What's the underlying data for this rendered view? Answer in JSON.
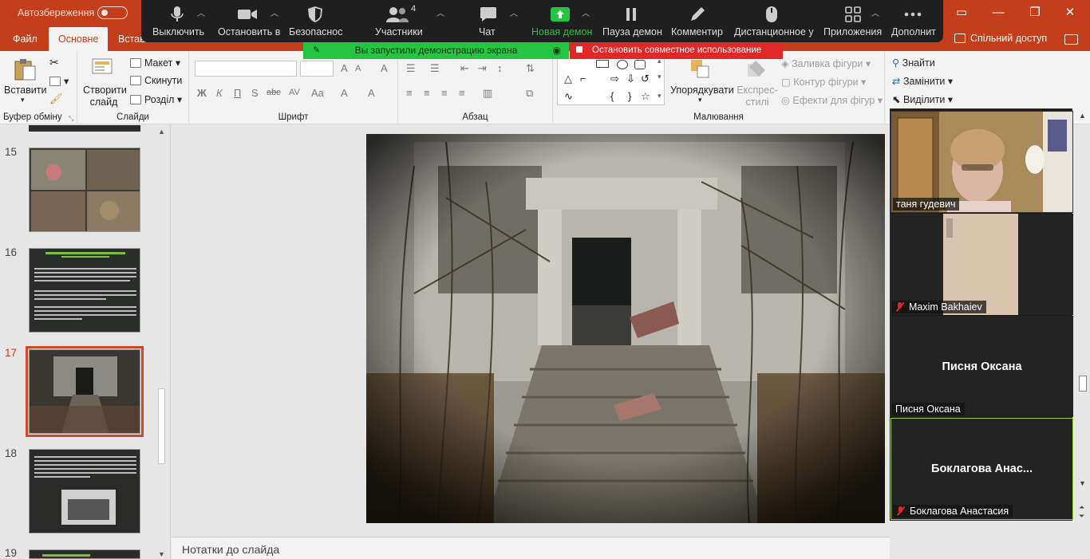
{
  "titlebar": {
    "autosave_label": "Автозбереження",
    "toggle_state": "Off"
  },
  "ribbon_tabs": [
    "Файл",
    "Основне",
    "Вставл"
  ],
  "share_label": "Спільний доступ",
  "ribbon": {
    "clipboard": {
      "paste": "Вставити",
      "group_label": "Буфер обміну"
    },
    "slides": {
      "new_slide": "Створити слайд",
      "layout": "Макет",
      "reset": "Скинути",
      "section": "Розділ",
      "group_label": "Слайди"
    },
    "font": {
      "group_label": "Шрифт",
      "bold": "Ж",
      "italic": "К",
      "underline": "П",
      "shadow": "S",
      "strike": "abc",
      "case": "Aa"
    },
    "paragraph": {
      "group_label": "Абзац"
    },
    "drawing": {
      "arrange": "Упорядкувати",
      "quick_styles": "Експрес-стилі",
      "shape_fill": "Заливка фігури",
      "shape_outline": "Контур фігури",
      "shape_effects": "Ефекти для фігур",
      "group_label": "Малювання"
    },
    "editing": {
      "find": "Знайти",
      "replace": "Замінити",
      "select": "Виділити"
    }
  },
  "zoom_toolbar": {
    "items": [
      {
        "label": "Выключить",
        "icon": "mic-icon"
      },
      {
        "label": "Остановить в",
        "icon": "video-icon"
      },
      {
        "label": "Безопаснос",
        "icon": "shield-icon"
      },
      {
        "label": "Участники",
        "icon": "participants-icon",
        "count": "4"
      },
      {
        "label": "Чат",
        "icon": "chat-icon"
      },
      {
        "label": "Новая демон",
        "icon": "share-screen-icon"
      },
      {
        "label": "Пауза демон",
        "icon": "pause-icon"
      },
      {
        "label": "Комментир",
        "icon": "pen-icon"
      },
      {
        "label": "Дистанционное у",
        "icon": "mouse-icon"
      },
      {
        "label": "Приложения",
        "icon": "apps-icon"
      },
      {
        "label": "Дополнит",
        "icon": "more-icon"
      }
    ],
    "share_banner": "Вы запустили демонстрацию экрана",
    "stop_banner": "Остановить совместное использование"
  },
  "thumbnails": [
    {
      "num": "15"
    },
    {
      "num": "16"
    },
    {
      "num": "17",
      "active": true
    },
    {
      "num": "18"
    },
    {
      "num": "19"
    }
  ],
  "notes_label": "Нотатки до слайда",
  "participants": [
    {
      "name": "таня гудевич",
      "muted": false,
      "video": true
    },
    {
      "name": "Maxim Bakhaiev",
      "muted": true,
      "video": true
    },
    {
      "name": "Писня Оксана",
      "display": "Писня Оксана",
      "muted": false,
      "video": false
    },
    {
      "name": "Боклагова Анастасия",
      "display": "Боклагова  Анас...",
      "muted": true,
      "video": false
    }
  ],
  "colors": {
    "accent": "#c43e1c",
    "zoom_green": "#23c542",
    "zoom_red": "#e02828",
    "active_speaker": "#9ad23a"
  }
}
